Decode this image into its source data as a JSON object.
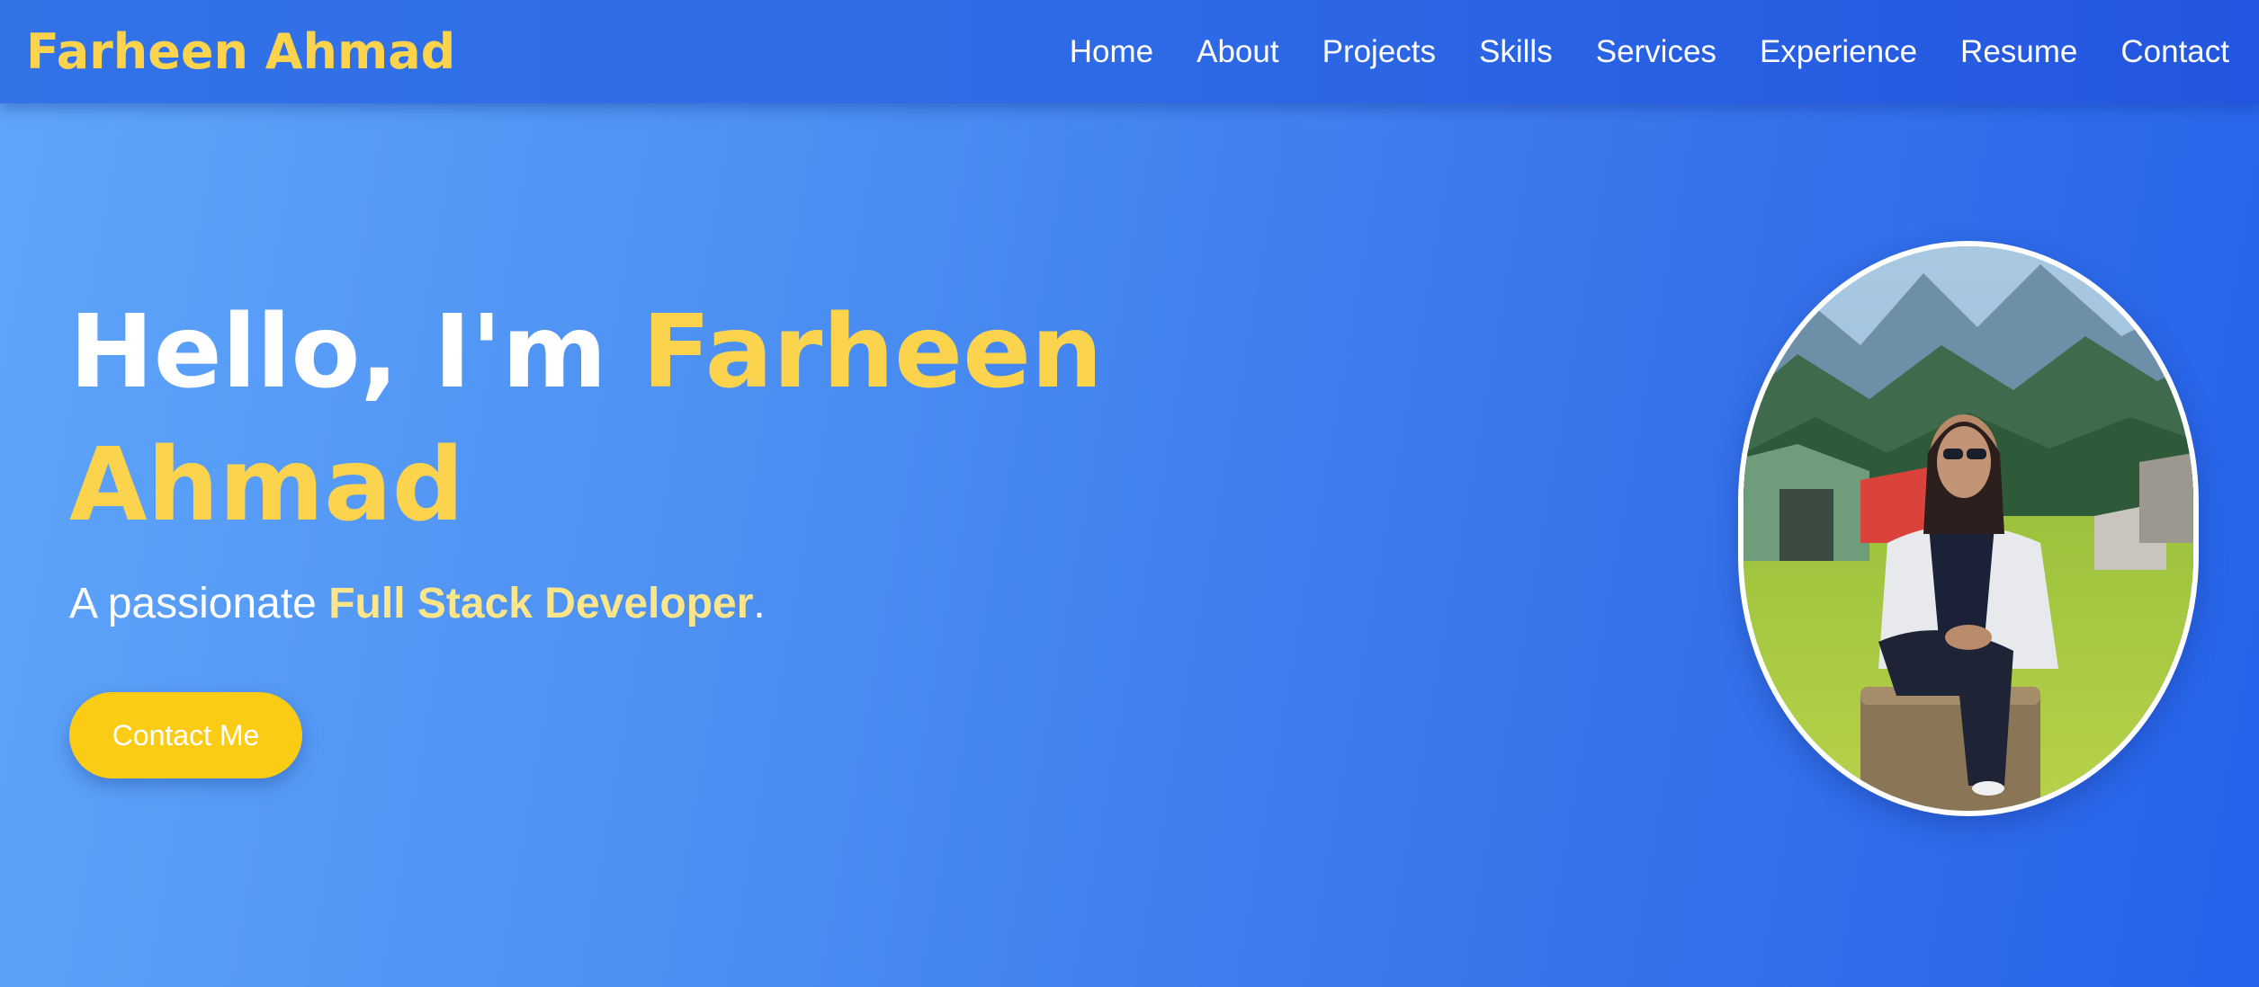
{
  "nav": {
    "brand": "Farheen Ahmad",
    "links": [
      "Home",
      "About",
      "Projects",
      "Skills",
      "Services",
      "Experience",
      "Resume",
      "Contact"
    ]
  },
  "hero": {
    "greeting": "Hello, I'm ",
    "name": "Farheen Ahmad",
    "tagline_prefix": "A passionate ",
    "tagline_role": "Full Stack Developer",
    "tagline_suffix": ".",
    "button_label": "Contact Me"
  },
  "colors": {
    "accent": "#fcd34d",
    "button": "#facc15",
    "nav_bg": "#2e6ae6",
    "bg_start": "#5fa5fa",
    "bg_end": "#2563eb"
  },
  "icons": {
    "profile_photo": "profile-photo"
  }
}
